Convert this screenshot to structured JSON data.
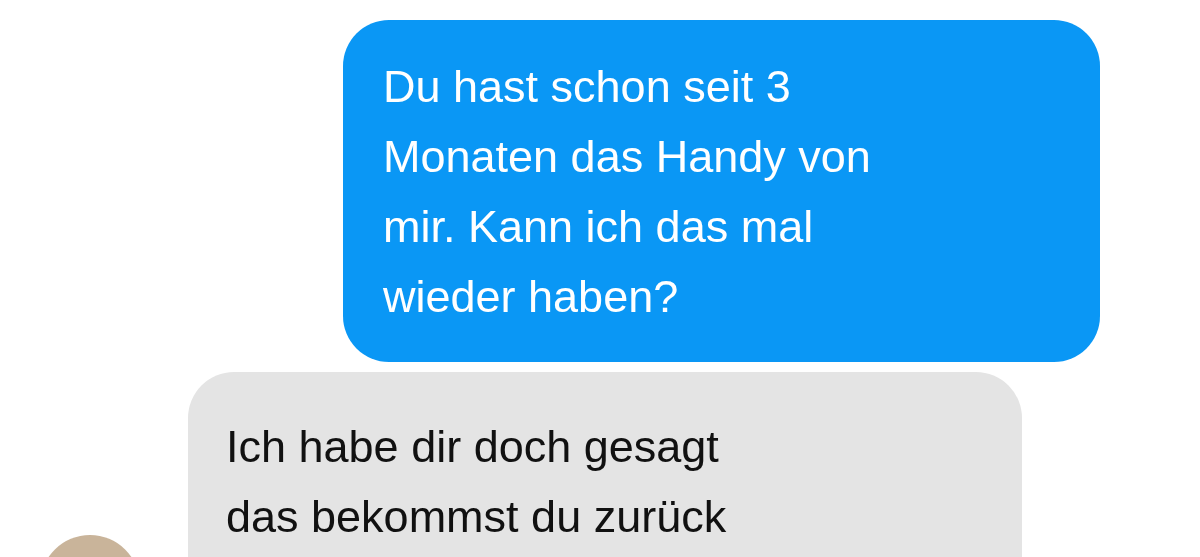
{
  "messages": [
    {
      "kind": "sent",
      "lines": [
        "Du hast schon seit 3",
        "Monaten das Handy von",
        "mir. Kann ich das mal",
        "wieder haben?"
      ]
    },
    {
      "kind": "received",
      "lines": [
        "Ich habe dir doch gesagt",
        "das bekommst du zurück"
      ]
    }
  ]
}
